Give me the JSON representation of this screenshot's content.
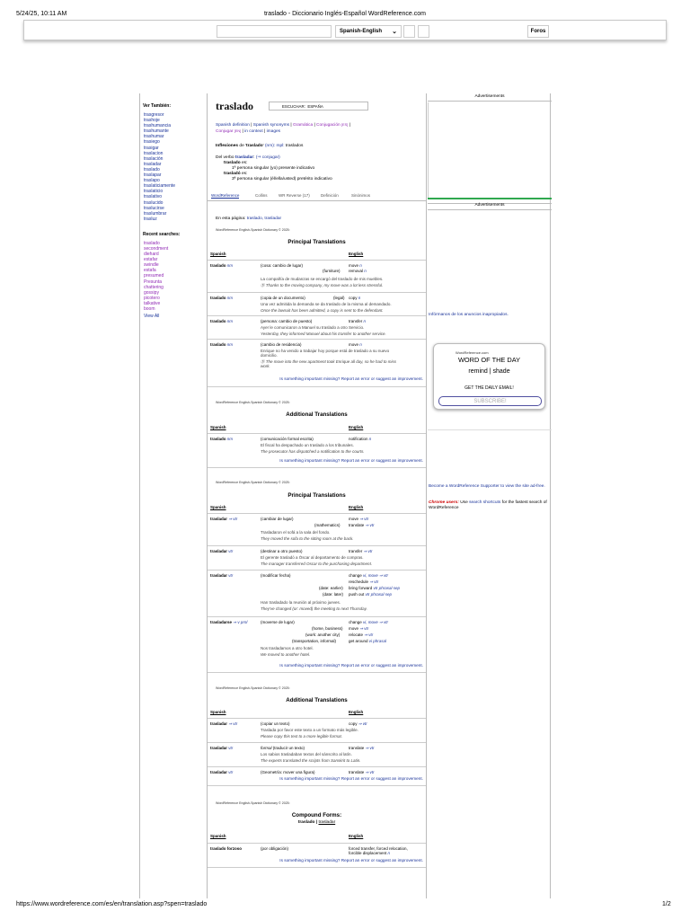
{
  "browser": {
    "datetime": "5/24/25, 10:11 AM",
    "tab_title": "traslado - Diccionario Inglés-Español WordReference.com",
    "url": "https://www.wordreference.com/es/en/translation.asp?spen=traslado",
    "page_num": "1/2"
  },
  "topbar": {
    "dict_select": "Spanish-English",
    "forums": "Foros"
  },
  "sidebar": {
    "see_also_title": "Ver También:",
    "see_also": [
      "trasgresor",
      "trashoje",
      "trashumancia",
      "trashumante",
      "trashumar",
      "trasiego",
      "trasigar",
      "traslacion",
      "traslación",
      "trasladar",
      "traslado",
      "traslapar",
      "traslapo",
      "traslaticiamente",
      "traslaticio",
      "traslativo",
      "traslucido",
      "traslucirse",
      "traslumbrar",
      "trasluz"
    ],
    "recent_title": "Recent searches:",
    "recent": [
      "traslado",
      "secondment",
      "diehard",
      "estafar",
      "swindle",
      "estafa",
      "presumed",
      "Presunta",
      "chattering",
      "gossipy",
      "picotero",
      "talkative",
      "boom"
    ],
    "view_all": "View All"
  },
  "main": {
    "headword": "traslado",
    "listen_label": "ESCUCHAR:",
    "listen_accent": "ESPAÑA",
    "links_line1": [
      "Spanish definition",
      "Spanish synonyms",
      "Gramática",
      "Conjugación"
    ],
    "conj_es": "[ES]",
    "links_line2": [
      "Conjugar",
      "in context",
      "images"
    ],
    "conj_en": "[EN]",
    "infl_prefix": "Inflexiones",
    "infl_de": "de '",
    "infl_word": "traslado",
    "infl_close": "'",
    "infl_nm": "(nm):",
    "infl_mpl": "mpl:",
    "infl_rest": "traslados",
    "verb_prefix": "Del verbo",
    "verb_word": "trasladar",
    "verb_conj": "(⇒ conjugar)",
    "verb_f1": "traslado",
    "verb_f1_es": "es:",
    "verb_f1_desc": "1ª persona singular (yo) presente indicativo",
    "verb_f2": "trasladó",
    "verb_f2_es": "es:",
    "verb_f2_desc": "3ª persona singular (él/ella/usted) pretérito indicativo",
    "tabs": [
      "WordReference",
      "Collins",
      "WR Reverse (17)",
      "Definición",
      "Sinónimos"
    ],
    "on_page_label": "En esta página:",
    "on_page_links": "traslado, trasladar",
    "credit": "WordReference English-Spanish Dictionary © 2025:",
    "principal_title": "Principal Translations",
    "additional_title": "Additional Translations",
    "col_spanish": "Spanish",
    "col_english": "English",
    "report": "Is something important missing? Report an error or suggest an improvement.",
    "s1": [
      {
        "src": "traslado",
        "pos": "nm",
        "ctx": "(cosa: cambio de lugar)",
        "tr": "move",
        "trpos": "n",
        "ctx2": "(furniture)",
        "tr2": "removal",
        "tr2pos": "n",
        "ex_es": "La compañía de mudanzas se encargó del traslado de mis muebles.",
        "ex_en": "Ⓢ Thanks to the moving company, my move was a lot less stressful."
      },
      {
        "src": "traslado",
        "pos": "nm",
        "ctx": "(copia de un documento)",
        "ctx2": "(legal)",
        "tr": "copy",
        "trpos": "n",
        "ex_es": "Una vez admitida la demanda se da traslado de la misma al demandado.",
        "ex_en": "Once the lawsuit has been admitted, a copy is sent to the defendant."
      },
      {
        "src": "traslado",
        "pos": "nm",
        "ctx": "(persona: cambio de puesto)",
        "tr": "transfer",
        "trpos": "n",
        "ex_es": "Ayer le comunicaron a Manuel su traslado a otro Servicio.",
        "ex_en": "Yesterday, they informed Manuel about his transfer to another service."
      },
      {
        "src": "traslado",
        "pos": "nm",
        "ctx": "(cambio de residencia)",
        "tr": "move",
        "trpos": "n",
        "ex_es": "Enrique no ha venido a trabajar hoy porque está de traslado a su nuevo",
        "ex_es2": "domicilio.",
        "ex_en": "Ⓢ The move into the new apartment took Enrique all day, so he had to miss",
        "ex_en2": "work."
      }
    ],
    "s2": [
      {
        "src": "traslado",
        "pos": "nm",
        "ctx": "(comunicación formal escrita)",
        "tr": "notification",
        "trpos": "n",
        "ex_es": "El fiscal ha despachado un traslado a los tribunales.",
        "ex_en": "The prosecutor has dispatched a notification to the courts."
      }
    ],
    "s3": [
      {
        "src": "trasladar",
        "pos": "⇒ vtr",
        "ctx": "(cambiar de lugar)",
        "tr": "move",
        "trpos": "⇒ vtr",
        "ctx2": "(mathematics)",
        "tr2": "translate",
        "tr2pos": "⇒ vtr",
        "ex_es": "Trasladaron el sofá a la sala del fondo.",
        "ex_en": "They moved the sofa to the sitting room at the back."
      },
      {
        "src": "trasladar",
        "pos": "vtr",
        "ctx": "(destinar a otro puesto)",
        "tr": "transfer",
        "trpos": "⇒ vtr",
        "ex_es": "El gerente trasladó a Óscar al departamento de compras.",
        "ex_en": "The manager transferred Oscar to the purchasing department."
      },
      {
        "src": "trasladar",
        "pos": "vtr",
        "ctx": "(modificar fecha)",
        "tr": "change",
        "trpos": "vi, move ⇒ vtr",
        "tr2": "reschedule",
        "tr2pos": "⇒ vtr",
        "ctx3": "(date: earlier)",
        "tr3": "bring forward",
        "tr3pos": "vtr phrasal sep",
        "ctx4": "(date: later)",
        "tr4": "push out",
        "tr4pos": "vtr phrasal sep",
        "ex_es": "Han trasladado la reunión al próximo jueves.",
        "ex_en": "They've changed (or: moved) the meeting to next Thursday."
      },
      {
        "src": "trasladarse",
        "pos": "⇒ v prnl",
        "ctx": "(moverse de lugar)",
        "tr": "change",
        "trpos": "vi, move ⇒ vtr",
        "ctx2": "(home, business)",
        "tr2": "move",
        "tr2pos": "⇒ vtr",
        "ctx3": "(work: another city)",
        "tr3": "relocate",
        "tr3pos": "⇒ vtr",
        "ctx4": "(transportation, informal)",
        "tr4": "get around",
        "tr4pos": "vi phrasal",
        "ex_es": "Nos trasladamos a otro hotel.",
        "ex_en": "We moved to another hotel."
      }
    ],
    "s4": [
      {
        "src": "trasladar",
        "pos": "⇒ vtr",
        "ctx": "(copiar un texto)",
        "tr": "copy",
        "trpos": "⇒ vtr",
        "ex_es": "Traslada por favor este texto a un formato más legible.",
        "ex_en": "Please copy this text to a more legible format."
      },
      {
        "src": "trasladar",
        "pos": "vtr",
        "ctx": "formal",
        "ctx_rest": "(traducir un texto)",
        "tr": "translate",
        "trpos": "⇒ vtr",
        "ex_es": "Los sabios trasladaban textos del sánscrito al latín.",
        "ex_en": "The experts translated the scripts from Sanskrit to Latin."
      },
      {
        "src": "trasladar",
        "pos": "vtr",
        "ctx": "(Geometría: mover una figura)",
        "tr": "translate",
        "trpos": "⇒ vtr"
      }
    ],
    "compound_title": "Compound Forms:",
    "compound_sub_a": "traslado",
    "compound_sub_b": "trasladar",
    "s5": [
      {
        "src": "traslado forzoso",
        "ctx": "(por obligación)",
        "tr": "forced transfer, forced relocation,",
        "tr_b": "forcible displacement",
        "trpos": "n"
      }
    ]
  },
  "right": {
    "ads": "Advertisements",
    "ads2": "Advertisements",
    "report_ads": "Infórmanos de los anuncios inapropiados.",
    "wod_site": "WordReference.com",
    "wod_title": "WORD OF THE DAY",
    "wod_words": "remind | shade",
    "wod_daily": "GET THE DAILY EMAIL!",
    "wod_subscribe": "SUBSCRIBE!",
    "supporter": "Become a WordReference Supporter to view the site ad-free.",
    "chrome_label": "Chrome users:",
    "chrome_pre": "Use",
    "chrome_link": "search shortcuts",
    "chrome_post": "for the fastest search of WordReference"
  },
  "colors": {
    "link": "#1a3399",
    "visited": "#912bb5",
    "green": "#0a8a3d",
    "red": "#cc0000"
  }
}
